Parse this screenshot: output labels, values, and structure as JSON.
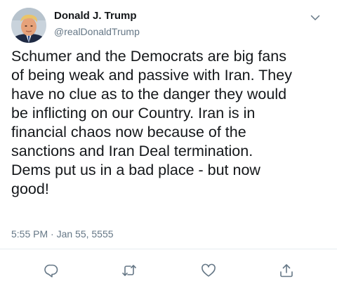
{
  "tweet": {
    "display_name": "Donald J. Trump",
    "handle": "@realDonaldTrump",
    "text": "Schumer and the Democrats are big fans\nof being weak and passive with Iran. They\nhave no clue as to the danger they would\nbe inflicting on our Country. Iran is in\nfinancial chaos now because of the\nsanctions and Iran Deal termination.\nDems put us in a bad place - but now\ngood!",
    "timestamp": "5:55 PM · Jan 55, 5555"
  },
  "icons": {
    "menu": "chevron-down-icon",
    "reply": "reply-icon",
    "retweet": "retweet-icon",
    "like": "heart-icon",
    "share": "share-icon"
  },
  "colors": {
    "text": "#14171a",
    "secondary": "#657786",
    "icon": "#657786",
    "divider": "#e6ecf0"
  }
}
